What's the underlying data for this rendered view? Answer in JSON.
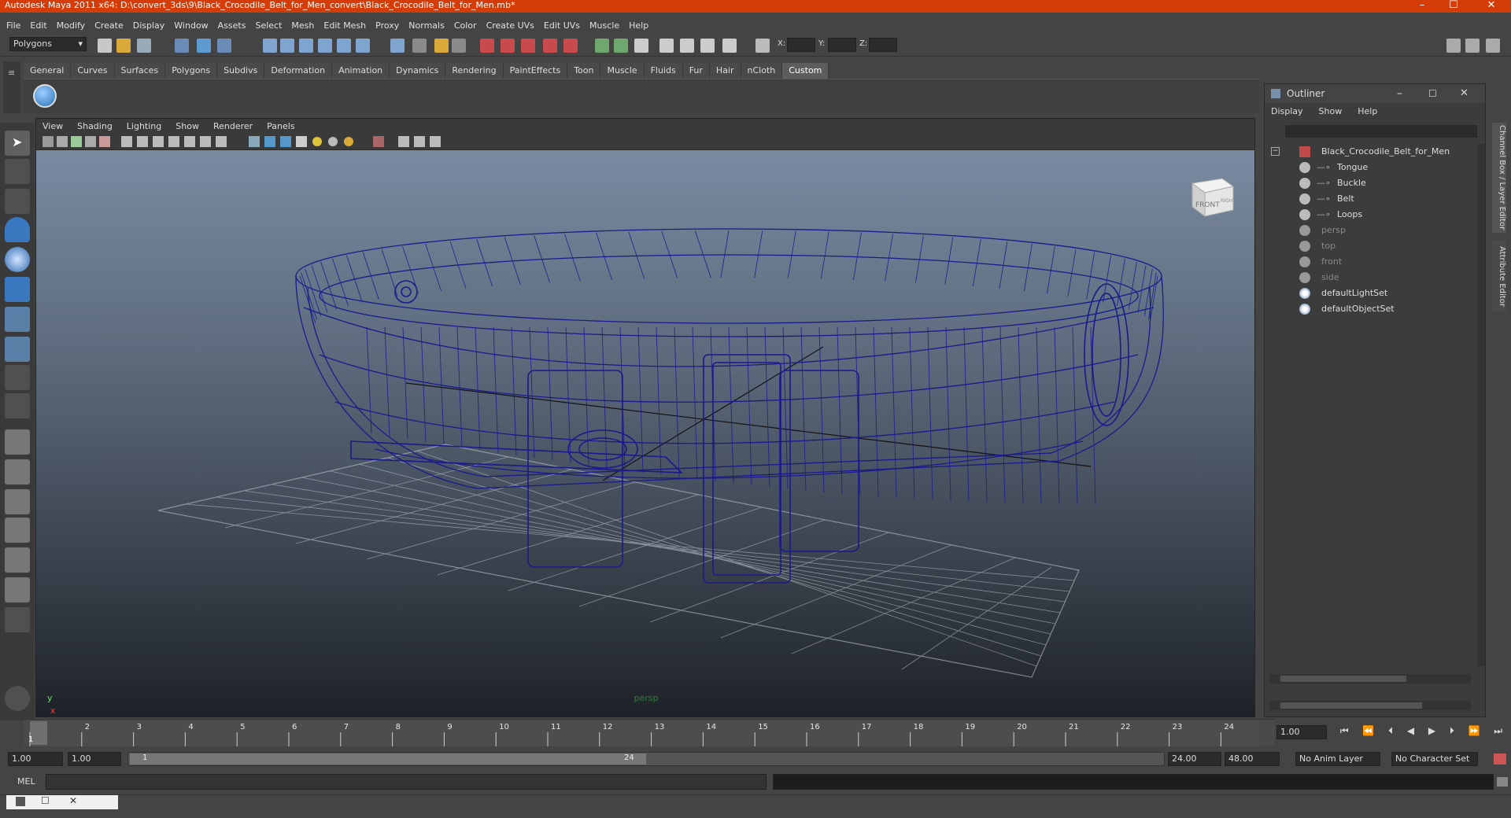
{
  "window": {
    "title": "Autodesk Maya 2011 x64: D:\\convert_3ds\\9\\Black_Crocodile_Belt_for_Men_convert\\Black_Crocodile_Belt_for_Men.mb*",
    "controls": [
      "–",
      "☐",
      "✕"
    ]
  },
  "menubar": [
    "File",
    "Edit",
    "Modify",
    "Create",
    "Display",
    "Window",
    "Assets",
    "Select",
    "Mesh",
    "Edit Mesh",
    "Proxy",
    "Normals",
    "Color",
    "Create UVs",
    "Edit UVs",
    "Muscle",
    "Help"
  ],
  "statusline": {
    "mode": "Polygons",
    "x_label": "X:",
    "y_label": "Y:",
    "z_label": "Z:"
  },
  "shelf": {
    "tabs": [
      "General",
      "Curves",
      "Surfaces",
      "Polygons",
      "Subdivs",
      "Deformation",
      "Animation",
      "Dynamics",
      "Rendering",
      "PaintEffects",
      "Toon",
      "Muscle",
      "Fluids",
      "Fur",
      "Hair",
      "nCloth",
      "Custom"
    ],
    "active_tab": "Custom"
  },
  "viewport": {
    "menu": [
      "View",
      "Shading",
      "Lighting",
      "Show",
      "Renderer",
      "Panels"
    ],
    "camera_label": "persp",
    "viewcube_front": "FRONT",
    "viewcube_right": "RIGHT",
    "axis_y": "y",
    "axis_x": "x",
    "wire_color": "#1a1a8c"
  },
  "outliner": {
    "title": "Outliner",
    "menu": [
      "Display",
      "Show",
      "Help"
    ],
    "items": [
      {
        "label": "Black_Crocodile_Belt_for_Men",
        "type": "group",
        "dim": false
      },
      {
        "label": "Tongue",
        "type": "mesh",
        "dim": false
      },
      {
        "label": "Buckle",
        "type": "mesh",
        "dim": false
      },
      {
        "label": "Belt",
        "type": "mesh",
        "dim": false
      },
      {
        "label": "Loops",
        "type": "mesh",
        "dim": false
      },
      {
        "label": "persp",
        "type": "camera",
        "dim": true
      },
      {
        "label": "top",
        "type": "camera",
        "dim": true
      },
      {
        "label": "front",
        "type": "camera",
        "dim": true
      },
      {
        "label": "side",
        "type": "camera",
        "dim": true
      },
      {
        "label": "defaultLightSet",
        "type": "set",
        "dim": false
      },
      {
        "label": "defaultObjectSet",
        "type": "set",
        "dim": false
      }
    ]
  },
  "sidebar_tabs": [
    "Channel Box / Layer Editor",
    "Attribute Editor"
  ],
  "timeline": {
    "ticks": [
      "1",
      "2",
      "3",
      "4",
      "5",
      "6",
      "7",
      "8",
      "9",
      "10",
      "11",
      "12",
      "13",
      "14",
      "15",
      "16",
      "17",
      "18",
      "19",
      "20",
      "21",
      "22",
      "23",
      "24"
    ],
    "current_frame": "1.00",
    "current_marker": "1"
  },
  "range": {
    "start": "1.00",
    "start_inner": "1.00",
    "slider_start": "1",
    "slider_end": "24",
    "end_inner": "24.00",
    "end": "48.00",
    "anim_layer": "No Anim Layer",
    "char_set": "No Character Set"
  },
  "cmdline": {
    "label": "MEL"
  }
}
